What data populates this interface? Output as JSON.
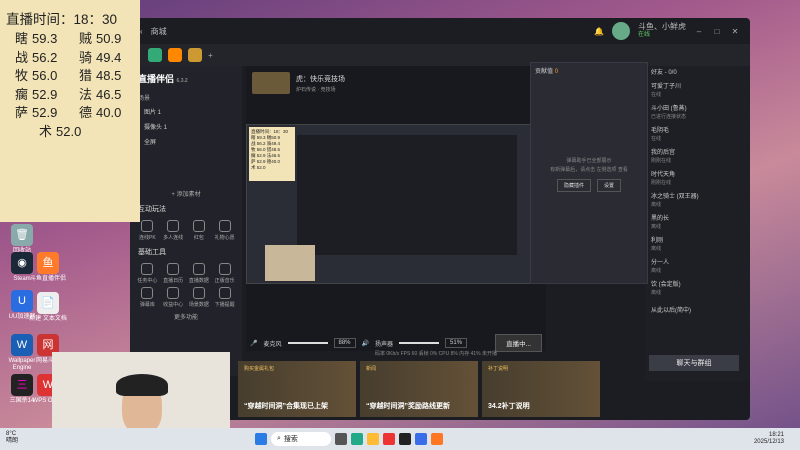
{
  "stats": {
    "title": "直播时间：18：30",
    "rows": [
      [
        {
          "n": "瞎",
          "v": "59.3"
        },
        {
          "n": "贼",
          "v": "50.9"
        }
      ],
      [
        {
          "n": "战",
          "v": "56.2"
        },
        {
          "n": "骑",
          "v": "49.4"
        }
      ],
      [
        {
          "n": "牧",
          "v": "56.0"
        },
        {
          "n": "猎",
          "v": "48.5"
        }
      ],
      [
        {
          "n": "瘸",
          "v": "52.9"
        },
        {
          "n": "法",
          "v": "46.5"
        }
      ],
      [
        {
          "n": "萨",
          "v": "52.9"
        },
        {
          "n": "德",
          "v": "40.0"
        }
      ]
    ],
    "last": {
      "n": "术",
      "v": "52.0"
    }
  },
  "app": {
    "nav_item": "商城",
    "user_name": "斗鱼、小鲜虎",
    "user_status": "在线"
  },
  "tool": {
    "logo": "直播伴侣",
    "version": "6.3.2",
    "scene_label": "场景",
    "scenes": [
      "图片 1",
      "摄像头 1",
      "全屏"
    ],
    "add_source": "添加素材",
    "section_play": "互动玩法",
    "section_basic": "基础工具",
    "more": "更多功能",
    "play_items": [
      "连线PK",
      "多人连线",
      "红包",
      "礼物心愿"
    ],
    "basic_items": [
      "任务中心",
      "直播日历",
      "直播数据",
      "正版音乐",
      "弹幕库",
      "收益中心",
      "场景数据",
      "下播提醒"
    ]
  },
  "stage": {
    "title": "虎：快乐竞技场",
    "tag1": "炉石传说 · 竞技场",
    "start_live": "开播设置",
    "share": "分享",
    "live_btn": "直播中...",
    "mic_pct": "88%",
    "speaker_pct": "51%",
    "mic_label": "麦克风",
    "speaker_label": "扬声器",
    "footer_stats": "码率 0Kb/s   FPS 60   丢帧 0%   CPU 8%   内存 41%   未开播"
  },
  "popup": {
    "title": "贡献值",
    "count": "0",
    "notice": "弹幕助手已全部展示",
    "hint": "有新弹幕后，请点击 左侧选项 查看",
    "btn1": "隐藏插件",
    "btn2": "设置"
  },
  "chat": {
    "items": [
      {
        "name": "好友 - 0/0",
        "sub": ""
      },
      {
        "name": "可爱丁子川",
        "sub": "在线"
      },
      {
        "name": "斗小田 (鲁蒸)",
        "sub": "已进行连接状态"
      },
      {
        "name": "毛阴毛",
        "sub": "在线"
      },
      {
        "name": "我的后宫",
        "sub": "刚刚在线"
      },
      {
        "name": "时代天角",
        "sub": "刚刚在线"
      },
      {
        "name": "冰之骑士 (双王器)",
        "sub": "离线"
      },
      {
        "name": "黑的长",
        "sub": "离线"
      },
      {
        "name": "利刚",
        "sub": "离线"
      },
      {
        "name": "分一人",
        "sub": "离线"
      },
      {
        "name": "饮 (会定版)",
        "sub": "离线"
      }
    ],
    "btn": "聊天与群组",
    "from_label": "从此以后(简中)"
  },
  "cards": [
    {
      "tag": "购买金属礼包",
      "text": "“穿越时间洞”合集现已上架"
    },
    {
      "tag": "新闻",
      "text": "“穿越时间洞”奖励路线更新"
    },
    {
      "tag": "补丁说明",
      "text": "34.2补丁说明"
    }
  ],
  "desktop_icons": [
    "回收站",
    "Steam",
    "斗鱼直播伴侣",
    "UU加速器",
    "新建 文本文档",
    "Wallpaper Engine",
    "网易斗鱼",
    "三国杀14",
    "WPS Office"
  ],
  "taskbar": {
    "search": "搜索",
    "time": "18:21",
    "date": "2025/12/13",
    "weather": "8°C",
    "weather_desc": "晴朗"
  },
  "colors": {
    "accent": "#ff5d23",
    "app_bg": "#1c1d22",
    "stats_bg": "#f3e4b7"
  }
}
